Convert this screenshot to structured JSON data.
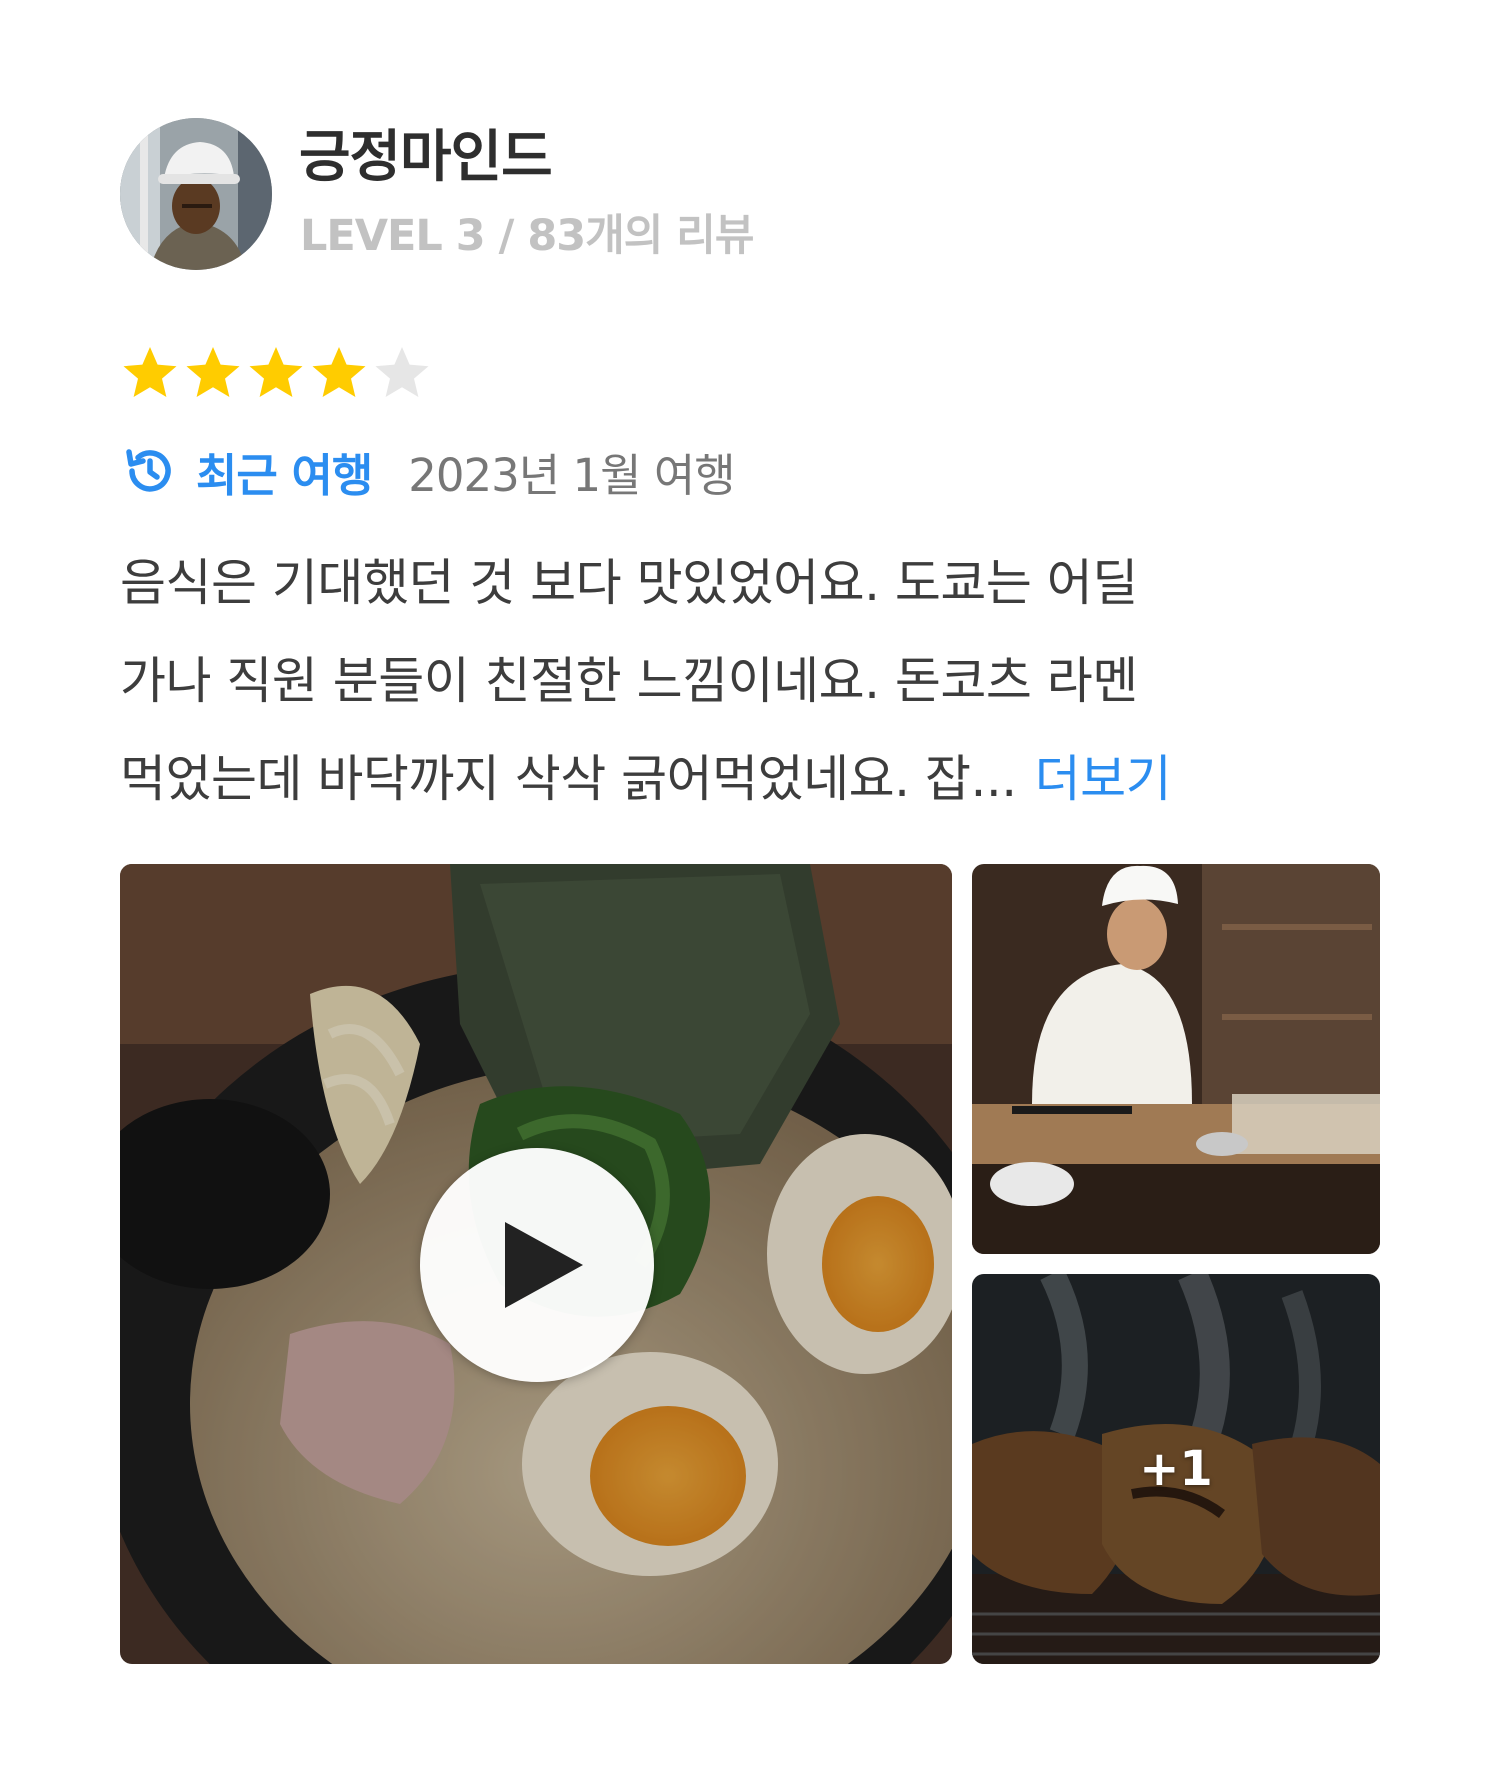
{
  "reviewer": {
    "name": "긍정마인드",
    "meta": "LEVEL 3 / 83개의 리뷰"
  },
  "rating": {
    "value": 4,
    "max": 5,
    "filled_color": "#FFCC00",
    "empty_color": "#E6E6E6"
  },
  "trip": {
    "icon": "history-icon",
    "label": "최근 여행",
    "date": "2023년 1월 여행"
  },
  "review": {
    "lines": [
      "음식은 기대했던 것 보다 맛있었어요. 도쿄는 어딜",
      "가나 직원 분들이 친절한 느낌이네요. 돈코츠 라멘",
      "먹었는데 바닥까지 삭삭 긁어먹었네요. 잡..."
    ],
    "more_label": "더보기"
  },
  "photos": {
    "main": {
      "subject": "ramen-video",
      "icon": "play-icon"
    },
    "second": {
      "subject": "sushi-chef-photo"
    },
    "third": {
      "subject": "grilled-meat-photo",
      "more_count": "+1"
    }
  },
  "colors": {
    "accent": "#2B8DF0",
    "text": "#3D3D3D",
    "muted": "#C2C2C2"
  }
}
